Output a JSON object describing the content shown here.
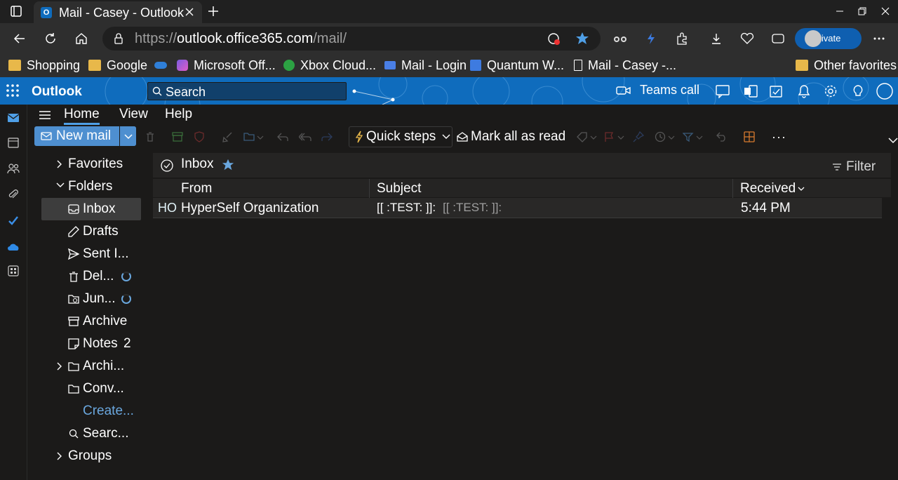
{
  "browser": {
    "tab_title": "Mail - Casey - Outlook",
    "tab_favicon": "O",
    "url_prefix": "https://",
    "url_host": "outlook.office365.com",
    "url_path": "/mail/",
    "inprivate_label": "InPrivate"
  },
  "favorites": [
    {
      "label": "Shopping",
      "icon": "folder-icon"
    },
    {
      "label": "Google",
      "icon": "folder-icon"
    },
    {
      "label": "Microsoft Off...",
      "icon": "copilot-icon"
    },
    {
      "label": "Xbox Cloud...",
      "icon": "xbox-icon"
    },
    {
      "label": "Mail - Login",
      "icon": "mail-icon"
    },
    {
      "label": "Quantum W...",
      "icon": "bookmark-icon"
    },
    {
      "label": "Mail - Casey -...",
      "icon": "page-icon"
    }
  ],
  "other_favorites": "Other favorites",
  "outlook": {
    "brand": "Outlook",
    "search_placeholder": "Search",
    "teams_call": "Teams call"
  },
  "ribbon": {
    "tabs": [
      "Home",
      "View",
      "Help"
    ],
    "new_mail": "New mail",
    "quick_steps": "Quick steps",
    "mark_all_read": "Mark all as read",
    "more": "···"
  },
  "folders": {
    "favorites": "Favorites",
    "folders": "Folders",
    "items": [
      {
        "label": "Inbox",
        "count": ""
      },
      {
        "label": "Drafts",
        "count": ""
      },
      {
        "label": "Sent I...",
        "count": ""
      },
      {
        "label": "Del...",
        "count": ""
      },
      {
        "label": "Jun...",
        "count": ""
      },
      {
        "label": "Archive",
        "count": ""
      },
      {
        "label": "Notes",
        "count": "2"
      },
      {
        "label": "Archi...",
        "count": ""
      },
      {
        "label": "Conv...",
        "count": ""
      },
      {
        "label": "Create...",
        "count": ""
      },
      {
        "label": "Searc...",
        "count": ""
      }
    ],
    "groups": "Groups"
  },
  "message_list": {
    "title": "Inbox",
    "filter": "Filter",
    "columns": {
      "from": "From",
      "subject": "Subject",
      "received": "Received"
    },
    "rows": [
      {
        "initials": "HO",
        "from": "HyperSelf Organization",
        "subject": "[[ :TEST: ]]:",
        "preview": "[[ :TEST: ]]:",
        "received": "5:44 PM"
      }
    ]
  },
  "colors": {
    "accent": "#0f6cbd",
    "selected": "#3d3d3d",
    "link": "#6aa7de"
  }
}
